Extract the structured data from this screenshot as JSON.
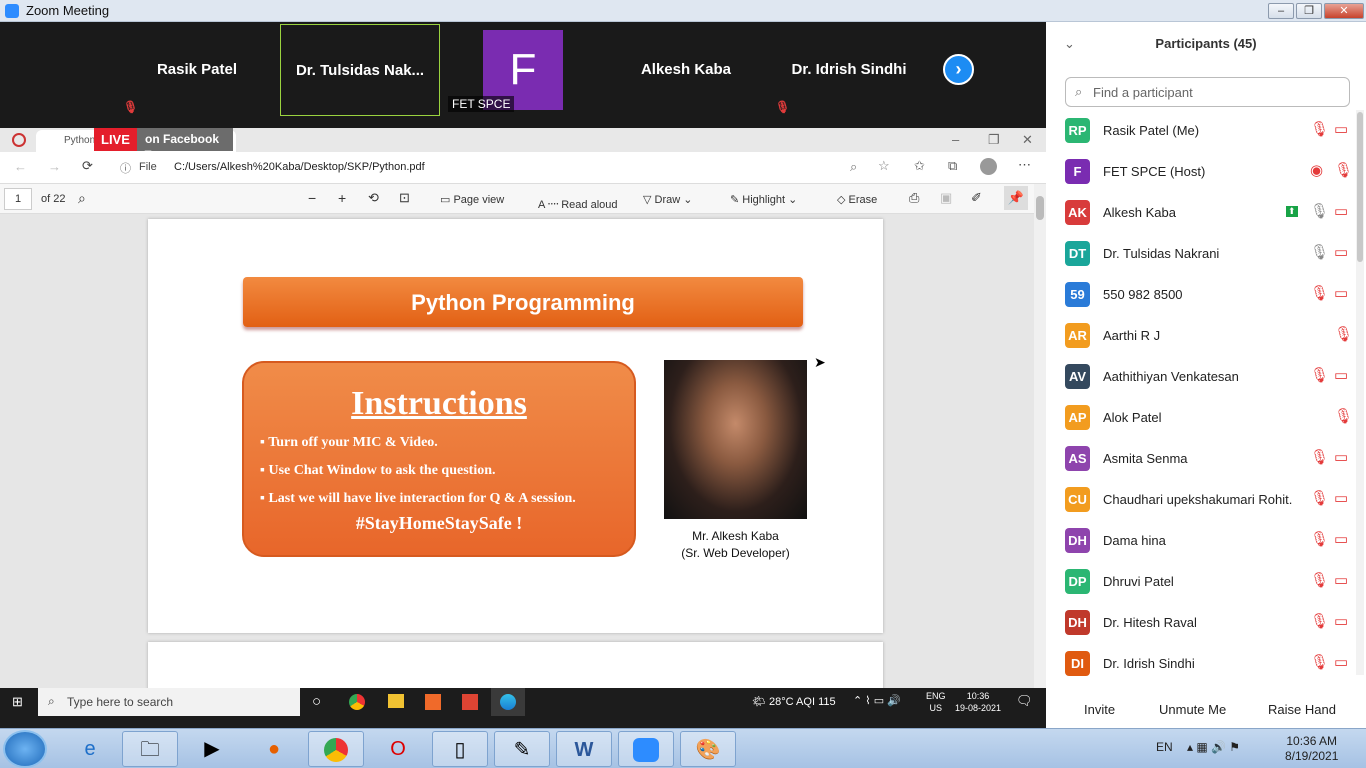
{
  "window": {
    "title": "Zoom Meeting"
  },
  "video_strip": {
    "tiles": [
      "Rasik Patel",
      "Dr. Tulsidas Nak...",
      "",
      "Alkesh Kaba",
      "Dr. Idrish Sindhi"
    ],
    "f_letter": "F",
    "f_name": "FET SPCE"
  },
  "browser": {
    "tab_title": "Python.p...",
    "live": "LIVE",
    "on_facebook": "on Facebook",
    "file_label": "File",
    "url": "C:/Users/Alkesh%20Kaba/Desktop/SKP/Python.pdf",
    "page_num": "1",
    "page_of": "of 22",
    "tools": {
      "page_view": "Page view",
      "read_aloud": "Read aloud",
      "draw": "Draw",
      "highlight": "Highlight",
      "erase": "Erase"
    }
  },
  "slide": {
    "banner": "Python  Programming",
    "instructions_title": "Instructions",
    "bullets": [
      "Turn off your MIC & Video.",
      "Use Chat Window to ask the question.",
      "Last we will have live interaction for Q & A session."
    ],
    "tagline": "#StayHomeStaySafe !",
    "presenter_name": "Mr. Alkesh Kaba",
    "presenter_role": "(Sr. Web Developer)"
  },
  "participants": {
    "title": "Participants (45)",
    "search_placeholder": "Find a participant",
    "list": [
      {
        "initials": "RP",
        "name": "Rasik Patel (Me)",
        "color": "#2bb673"
      },
      {
        "initials": "F",
        "name": "FET SPCE (Host)",
        "color": "#7a2cb1"
      },
      {
        "initials": "AK",
        "name": "Alkesh Kaba",
        "color": "#d83b3b"
      },
      {
        "initials": "DT",
        "name": "Dr. Tulsidas Nakrani",
        "color": "#1aa69a"
      },
      {
        "initials": "59",
        "name": "550 982 8500",
        "color": "#2a7bd8"
      },
      {
        "initials": "AR",
        "name": "Aarthi R J",
        "color": "#f29c1f"
      },
      {
        "initials": "AV",
        "name": "Aathithiyan Venkatesan",
        "color": "#34495e"
      },
      {
        "initials": "AP",
        "name": "Alok Patel",
        "color": "#f29c1f"
      },
      {
        "initials": "AS",
        "name": "Asmita Senma",
        "color": "#8e44ad"
      },
      {
        "initials": "CU",
        "name": "Chaudhari upekshakumari Rohit...",
        "color": "#f29c1f"
      },
      {
        "initials": "DH",
        "name": "Dama hina",
        "color": "#8e44ad"
      },
      {
        "initials": "DP",
        "name": "Dhruvi Patel",
        "color": "#2bb673"
      },
      {
        "initials": "DH",
        "name": "Dr. Hitesh Raval",
        "color": "#c0392b"
      },
      {
        "initials": "DI",
        "name": "Dr. Idrish Sindhi",
        "color": "#e05a10"
      }
    ],
    "buttons": [
      "Invite",
      "Unmute Me",
      "Raise Hand"
    ]
  },
  "inner_taskbar": {
    "search": "Type here to search",
    "weather": "28°C  AQI 115",
    "lang": "ENG",
    "region": "US",
    "time": "10:36",
    "date": "19-08-2021"
  },
  "taskbar": {
    "lang": "EN",
    "time": "10:36 AM",
    "date": "8/19/2021"
  }
}
